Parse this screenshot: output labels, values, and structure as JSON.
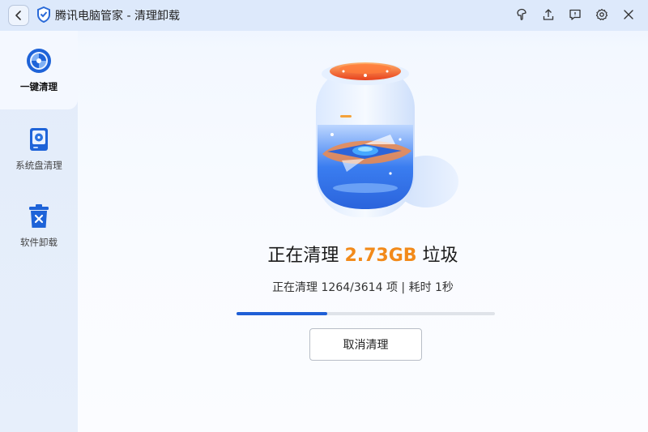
{
  "window": {
    "title": "腾讯电脑管家 - 清理卸载",
    "icons": [
      "back-icon",
      "shield-logo-icon",
      "skin-icon",
      "upload-icon",
      "feedback-icon",
      "settings-icon",
      "close-icon"
    ]
  },
  "sidebar": {
    "items": [
      {
        "label": "一键清理",
        "icon": "one-click-clean-icon",
        "active": true
      },
      {
        "label": "系统盘清理",
        "icon": "system-disk-clean-icon",
        "active": false
      },
      {
        "label": "软件卸载",
        "icon": "software-uninstall-icon",
        "active": false
      }
    ]
  },
  "main": {
    "headline_prefix": "正在清理",
    "headline_size": "2.73GB",
    "headline_suffix": "垃圾",
    "status_prefix": "正在清理",
    "status_progress": "1264/3614",
    "status_unit": "项",
    "status_separator": "|",
    "status_elapsed": "耗时 1秒",
    "progress_fraction": 0.35,
    "cancel_label": "取消清理"
  },
  "colors": {
    "accent": "#1f5fd6",
    "size_highlight": "#f28a1a",
    "titlebar": "#dde9fb"
  }
}
